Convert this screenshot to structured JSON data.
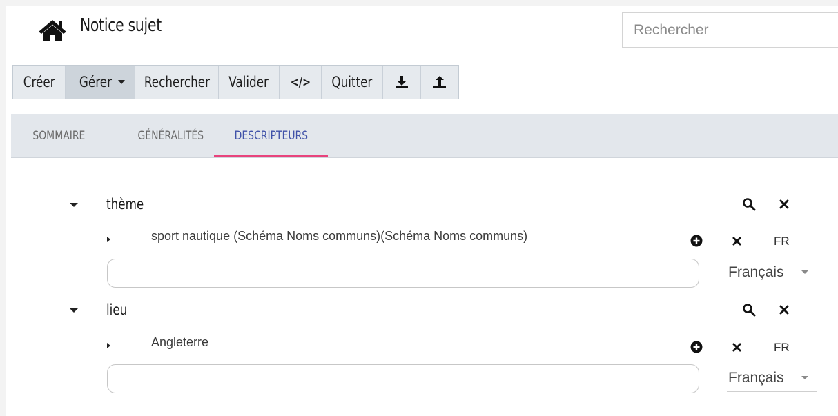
{
  "header": {
    "title": "Notice sujet",
    "search_placeholder": "Rechercher"
  },
  "toolbar": {
    "creer": "Créer",
    "gerer": "Gérer",
    "rechercher": "Rechercher",
    "valider": "Valider",
    "code": "</>",
    "quitter": "Quitter",
    "download_icon": "download-icon",
    "upload_icon": "upload-icon"
  },
  "tabs": [
    {
      "label": "SOMMAIRE",
      "active": false
    },
    {
      "label": "GÉNÉRALITÉS",
      "active": false
    },
    {
      "label": "DESCRIPTEURS",
      "active": true
    }
  ],
  "sections": [
    {
      "label": "thème",
      "value": "sport nautique (Schéma Noms communs)(Schéma Noms communs)",
      "lang_code": "FR",
      "input_value": "",
      "language": "Français"
    },
    {
      "label": "lieu",
      "value": "Angleterre",
      "lang_code": "FR",
      "input_value": "",
      "language": "Français"
    }
  ],
  "colors": {
    "active_tab_text": "#3f51a8",
    "active_tab_underline": "#e8437c",
    "toolbar_bg": "#e6eaee",
    "tabbar_bg": "#e3e7ec"
  }
}
